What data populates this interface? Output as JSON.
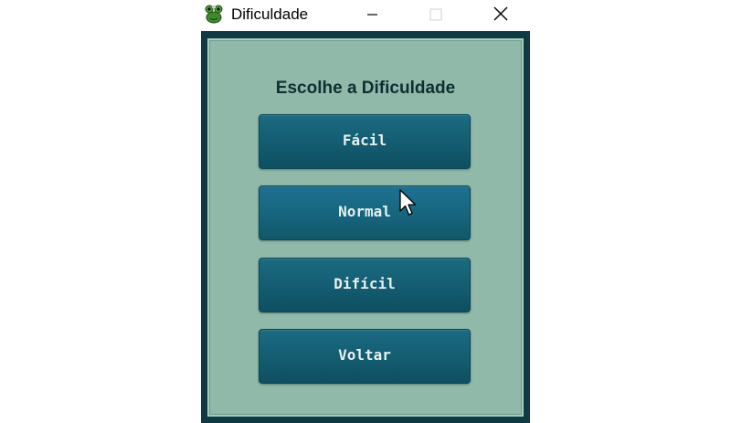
{
  "window": {
    "title": "Dificuldade",
    "icon": "green-frog-icon",
    "controls": [
      "minimize",
      "maximize",
      "close"
    ]
  },
  "menu": {
    "heading": "Escolhe a Dificuldade",
    "buttons": {
      "easy": "Fácil",
      "normal": "Normal",
      "hard": "Difícil",
      "back": "Voltar"
    }
  },
  "colors": {
    "frame": "#0f3a44",
    "panel": "#90b9a9",
    "button": "#145d72",
    "button_text": "#e8f0f0",
    "heading_text": "#0f2e33"
  }
}
